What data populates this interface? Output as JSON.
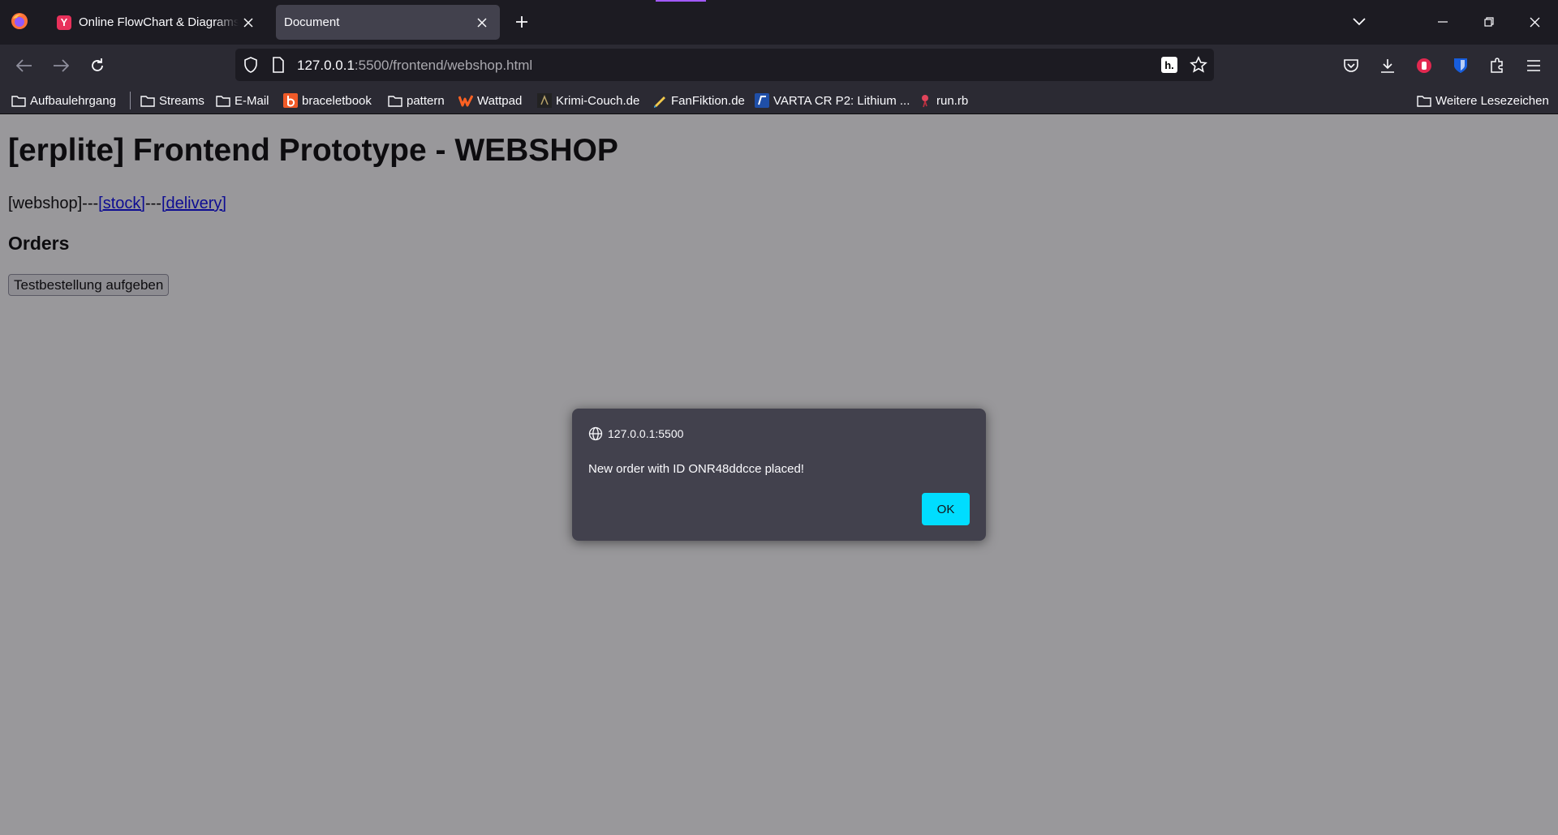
{
  "browser": {
    "tabs": [
      {
        "title": "Online FlowChart & Diagrams E",
        "favicon_letter": "Y",
        "active": false
      },
      {
        "title": "Document",
        "active": true
      }
    ],
    "url": {
      "host": "127.0.0.1",
      "rest": ":5500/frontend/webshop.html"
    },
    "h_badge": "h.",
    "bookmarks": [
      {
        "label": "Aufbaulehrgang",
        "icon": "folder-icon"
      },
      {
        "label": "Streams",
        "icon": "folder-icon"
      },
      {
        "label": "E-Mail",
        "icon": "folder-icon"
      },
      {
        "label": "braceletbook",
        "icon": "braceletbook-icon"
      },
      {
        "label": "pattern",
        "icon": "folder-icon"
      },
      {
        "label": "Wattpad",
        "icon": "wattpad-icon"
      },
      {
        "label": "Krimi-Couch.de",
        "icon": "krimi-couch-icon"
      },
      {
        "label": "FanFiktion.de",
        "icon": "fanfiktion-icon"
      },
      {
        "label": "VARTA CR P2: Lithium ...",
        "icon": "varta-icon"
      },
      {
        "label": "run.rb",
        "icon": "run-rb-icon"
      }
    ],
    "other_bookmarks": "Weitere Lesezeichen",
    "colors": {
      "accent": "#00ddff",
      "ok_text": "#15141a",
      "tab_active": "#42414d",
      "toolbar": "#2b2a33",
      "shield_red": "#e22850",
      "bitwarden_blue": "#175ddc"
    }
  },
  "page": {
    "heading": "[erplite] Frontend Prototype - WEBSHOP",
    "nav": {
      "current": "[webshop]",
      "separator": "---",
      "stock_link": "[stock]",
      "delivery_link": "[delivery]"
    },
    "section_title": "Orders",
    "test_button": "Testbestellung aufgeben"
  },
  "dialog": {
    "origin": "127.0.0.1:5500",
    "message": "New order with ID ONR48ddcce placed!",
    "ok_label": "OK"
  }
}
